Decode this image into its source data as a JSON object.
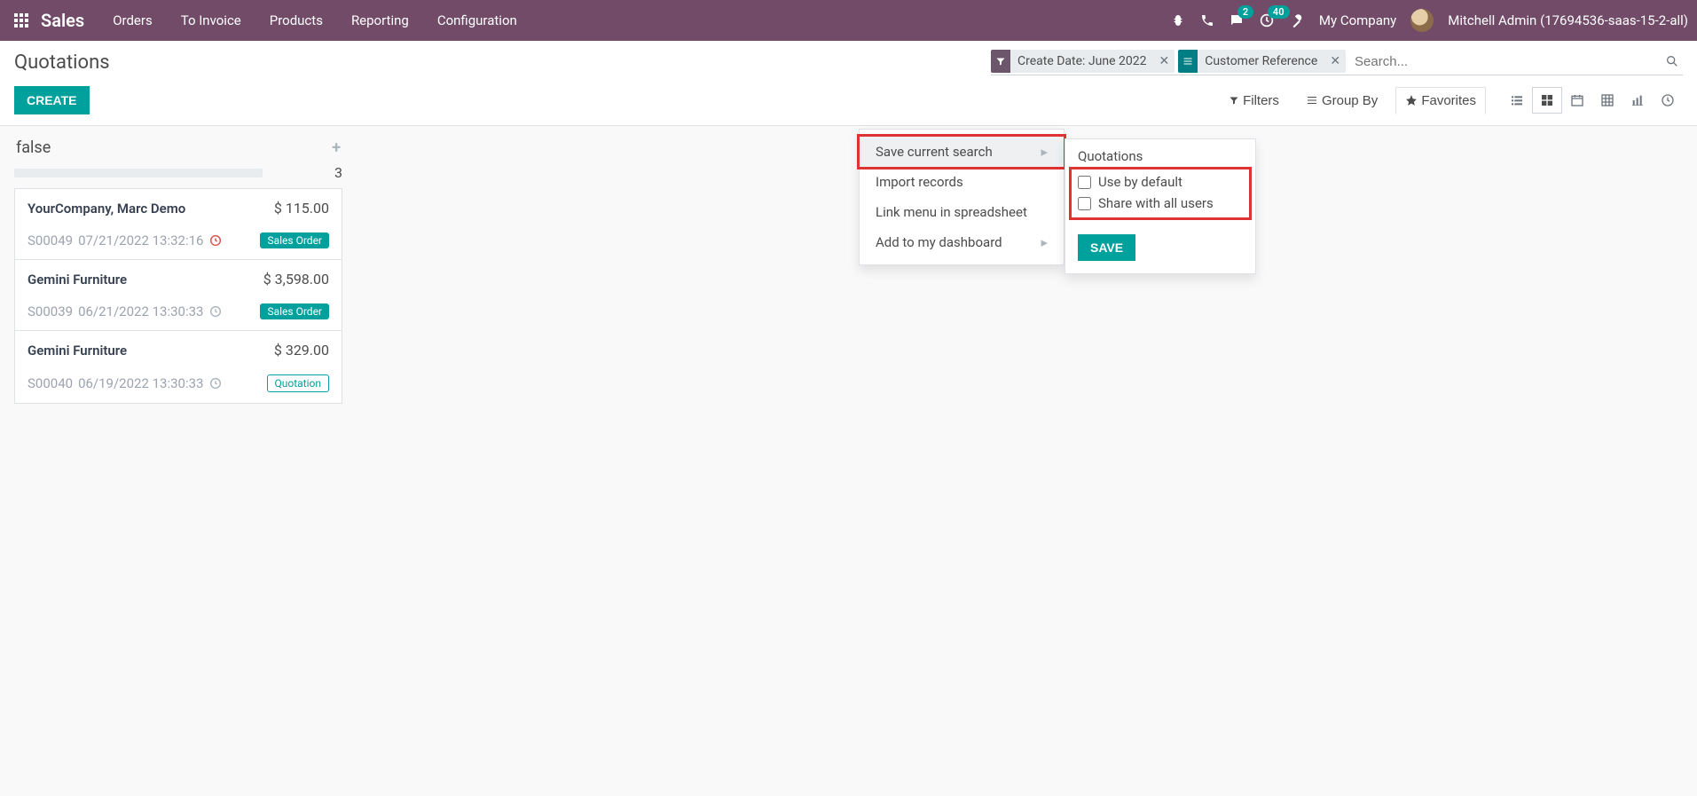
{
  "nav": {
    "brand": "Sales",
    "items": [
      "Orders",
      "To Invoice",
      "Products",
      "Reporting",
      "Configuration"
    ],
    "messaging_badge": "2",
    "activities_badge": "40",
    "company": "My Company",
    "user": "Mitchell Admin (17694536-saas-15-2-all)"
  },
  "cp": {
    "breadcrumb": "Quotations",
    "create": "CREATE",
    "facets": [
      {
        "type": "filter",
        "label": "Create Date: June 2022"
      },
      {
        "type": "group",
        "label": "Customer Reference"
      }
    ],
    "search_placeholder": "Search...",
    "filters_label": "Filters",
    "groupby_label": "Group By",
    "favorites_label": "Favorites"
  },
  "fav_menu": {
    "save_current": "Save current search",
    "import_records": "Import records",
    "link_spreadsheet": "Link menu in spreadsheet",
    "add_dashboard": "Add to my dashboard"
  },
  "save_sub": {
    "name": "Quotations",
    "use_default": "Use by default",
    "share_all": "Share with all users",
    "save_btn": "SAVE"
  },
  "kanban": {
    "col_title": "false",
    "count": "3",
    "cards": [
      {
        "customer": "YourCompany, Marc Demo",
        "amount": "$ 115.00",
        "ref": "S00049",
        "dt": "07/21/2022 13:32:16",
        "late": true,
        "tag": "Sales Order",
        "tag_style": "sales"
      },
      {
        "customer": "Gemini Furniture",
        "amount": "$ 3,598.00",
        "ref": "S00039",
        "dt": "06/21/2022 13:30:33",
        "late": false,
        "tag": "Sales Order",
        "tag_style": "sales"
      },
      {
        "customer": "Gemini Furniture",
        "amount": "$ 329.00",
        "ref": "S00040",
        "dt": "06/19/2022 13:30:33",
        "late": false,
        "tag": "Quotation",
        "tag_style": "quote"
      }
    ]
  }
}
